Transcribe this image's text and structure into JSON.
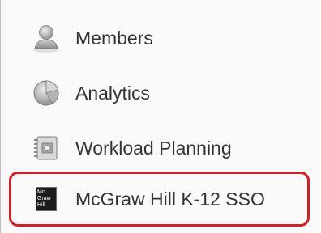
{
  "menu": {
    "items": [
      {
        "label": "Members",
        "icon": "person-icon"
      },
      {
        "label": "Analytics",
        "icon": "pie-chart-icon"
      },
      {
        "label": "Workload Planning",
        "icon": "planner-icon"
      },
      {
        "label": "McGraw Hill K-12 SSO",
        "icon": "mcgraw-hill-logo-icon",
        "highlighted": true
      }
    ],
    "logo_text": [
      "Mc",
      "Graw",
      "Hill"
    ]
  },
  "colors": {
    "highlight_border": "#d0202a",
    "panel_background": "#f9f9f9",
    "text": "#333333"
  }
}
